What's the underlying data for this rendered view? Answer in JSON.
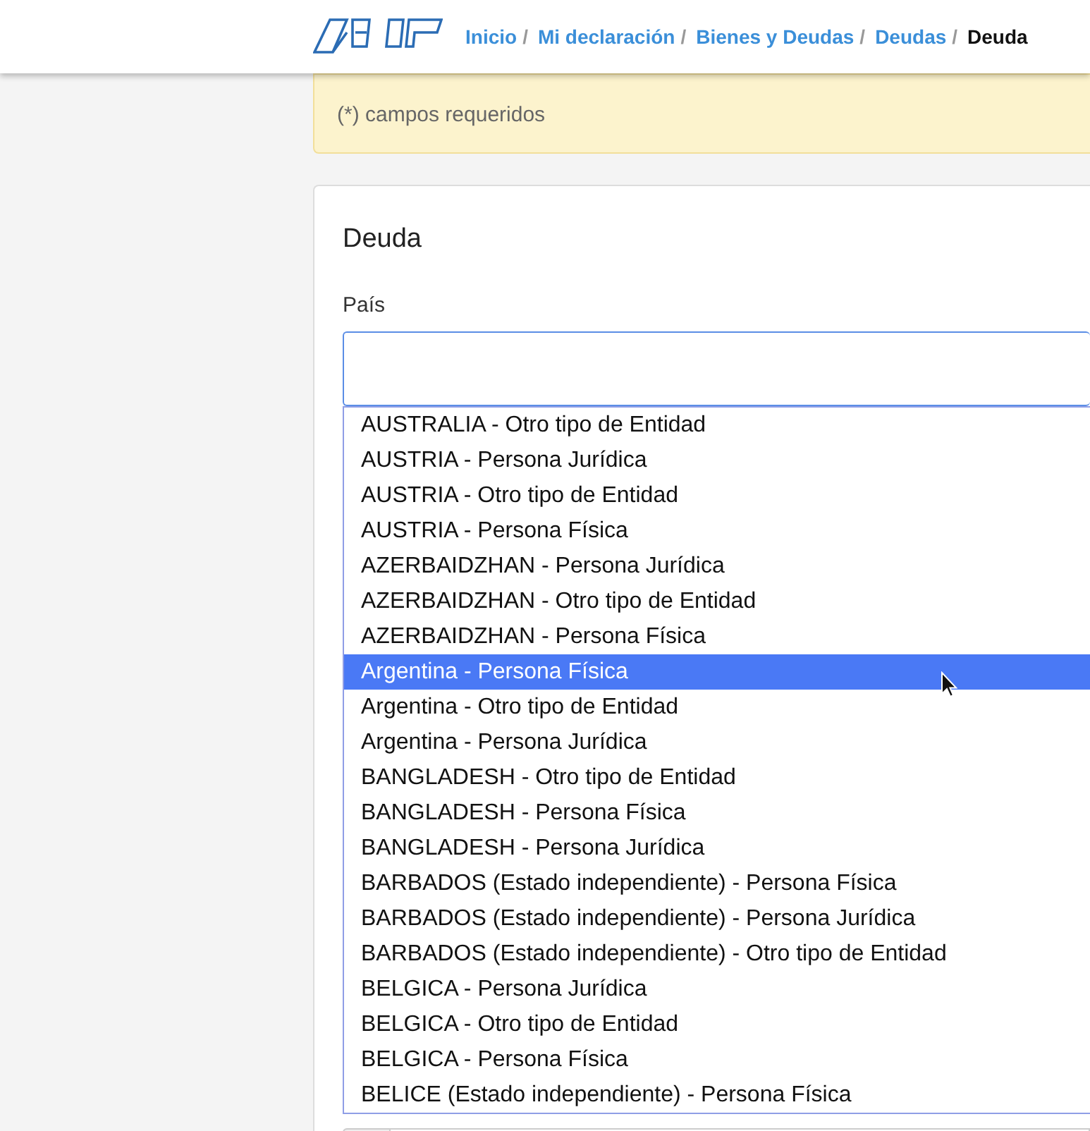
{
  "breadcrumb": [
    {
      "label": "Inicio",
      "active": false,
      "separator": "/"
    },
    {
      "label": "Mi declaración",
      "active": false,
      "separator": "/"
    },
    {
      "label": "Bienes y Deudas",
      "active": false,
      "separator": "/"
    },
    {
      "label": "Deudas",
      "active": false,
      "separator": "/"
    },
    {
      "label": "Deuda",
      "active": true
    }
  ],
  "warning": {
    "text": "(*) campos requeridos"
  },
  "form": {
    "title": "Deuda",
    "field_label": "País",
    "options": [
      {
        "label": "AUSTRALIA - Otro tipo de Entidad",
        "selected": false
      },
      {
        "label": "AUSTRIA - Persona Jurídica",
        "selected": false
      },
      {
        "label": "AUSTRIA - Otro tipo de Entidad",
        "selected": false
      },
      {
        "label": "AUSTRIA - Persona Física",
        "selected": false
      },
      {
        "label": "AZERBAIDZHAN - Persona Jurídica",
        "selected": false
      },
      {
        "label": "AZERBAIDZHAN - Otro tipo de Entidad",
        "selected": false
      },
      {
        "label": "AZERBAIDZHAN - Persona Física",
        "selected": false
      },
      {
        "label": "Argentina - Persona Física",
        "selected": true
      },
      {
        "label": "Argentina - Otro tipo de Entidad",
        "selected": false
      },
      {
        "label": "Argentina - Persona Jurídica",
        "selected": false
      },
      {
        "label": "BANGLADESH - Otro tipo de Entidad",
        "selected": false
      },
      {
        "label": "BANGLADESH - Persona Física",
        "selected": false
      },
      {
        "label": "BANGLADESH - Persona Jurídica",
        "selected": false
      },
      {
        "label": "BARBADOS (Estado independiente) - Persona Física",
        "selected": false
      },
      {
        "label": "BARBADOS (Estado independiente) - Persona Jurídica",
        "selected": false
      },
      {
        "label": "BARBADOS (Estado independiente) - Otro tipo de Entidad",
        "selected": false
      },
      {
        "label": "BELGICA - Persona Jurídica",
        "selected": false
      },
      {
        "label": "BELGICA - Otro tipo de Entidad",
        "selected": false
      },
      {
        "label": "BELGICA - Persona Física",
        "selected": false
      },
      {
        "label": "BELICE (Estado independiente) - Persona Física",
        "selected": false
      }
    ]
  }
}
